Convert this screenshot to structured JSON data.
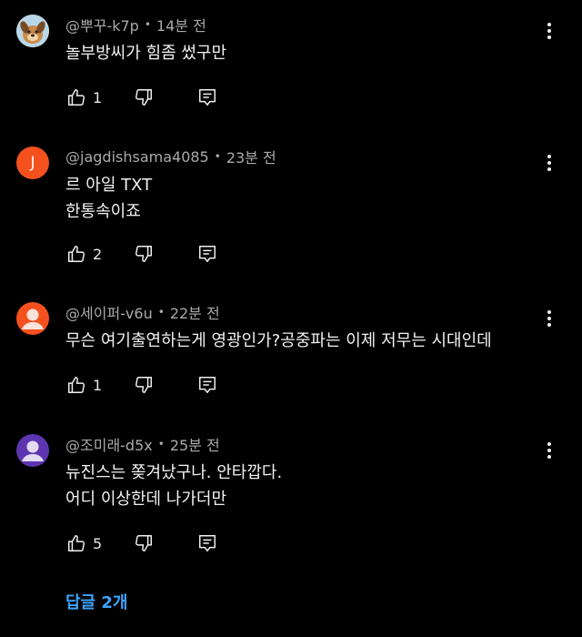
{
  "comments": [
    {
      "username": "@뿌꾸-k7p",
      "time": "14분 전",
      "lines": [
        "놀부방씨가 힘좀 썼구만"
      ],
      "likes": "1",
      "avatar": {
        "type": "image",
        "icon": "cartoon-dog-avatar"
      }
    },
    {
      "username": "@jagdishsama4085",
      "time": "23분 전",
      "lines": [
        "르 아일 TXT",
        "한통속이죠"
      ],
      "likes": "2",
      "avatar": {
        "type": "letter",
        "letter": "J",
        "color": "#f4511e"
      }
    },
    {
      "username": "@세이퍼-v6u",
      "time": "22분 전",
      "lines": [
        "무슨 여기출연하는게 영광인가?공중파는 이제 저무는 시대인데"
      ],
      "likes": "1",
      "avatar": {
        "type": "person",
        "color": "#f4511e",
        "icon": "person-icon"
      }
    },
    {
      "username": "@조미래-d5x",
      "time": "25분 전",
      "lines": [
        "뉴진스는 쫒겨났구나. 안타깝다.",
        "어디 이상한데 나가더만"
      ],
      "likes": "5",
      "avatar": {
        "type": "person",
        "color": "#5e35b1",
        "icon": "person-icon"
      }
    }
  ],
  "separator": "•",
  "replies_label": "답글 2개",
  "colors": {
    "accent_link": "#3ea6ff",
    "meta": "#aaaaaa",
    "text": "#f1f1f1",
    "background": "#000000"
  }
}
